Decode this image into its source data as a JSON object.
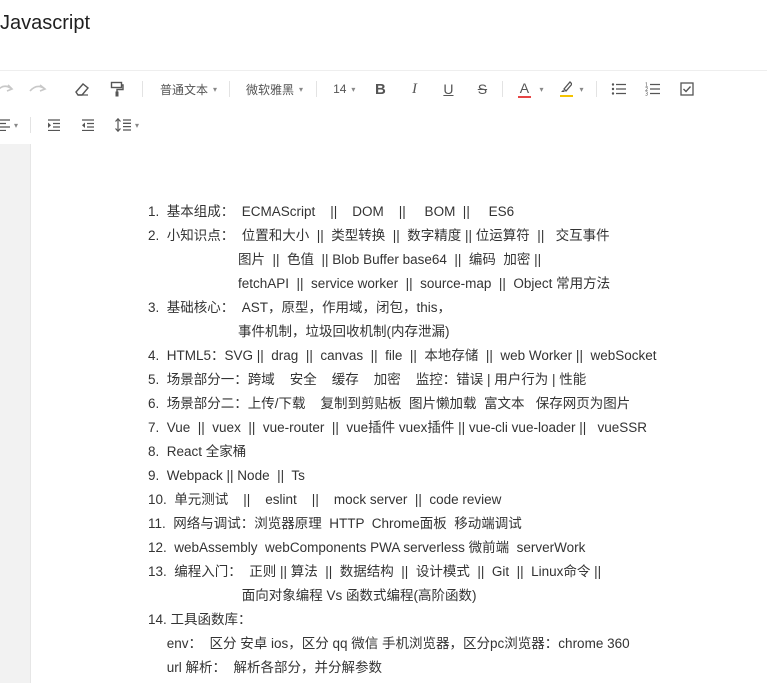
{
  "title": "Javascript",
  "toolbar": {
    "paragraph_style": "普通文本",
    "font_family": "微软雅黑",
    "font_size": "14",
    "bold": "B",
    "italic": "I",
    "underline": "U",
    "strike": "S",
    "font_color_letter": "A",
    "font_color": "#e64545",
    "highlight_color": "#f5c400"
  },
  "document": {
    "lines": [
      "1.  基本组成：  ECMAScript    ||    DOM    ||     BOM  ||     ES6",
      "2.  小知识点：  位置和大小  ||  类型转换  ||  数字精度 || 位运算符  ||   交互事件",
      "                        图片  ||  色值  || Blob Buffer base64  ||  编码  加密 ||",
      "                        fetchAPI  ||  service worker  ||  source-map  ||  Object 常用方法",
      "3.  基础核心：  AST，原型，作用域，闭包，this，",
      "                        事件机制，垃圾回收机制(内存泄漏)",
      "4.  HTML5：SVG ||  drag  ||  canvas  ||  file  ||  本地存储  ||  web Worker ||  webSocket",
      "5.  场景部分一：跨域    安全    缓存    加密    监控：错误 | 用户行为 | 性能",
      "6.  场景部分二：上传/下载    复制到剪贴板  图片懒加载  富文本   保存网页为图片",
      "7.  Vue  ||  vuex  ||  vue-router  ||  vue插件 vuex插件 || vue-cli vue-loader ||   vueSSR",
      "8.  React 全家桶",
      "9.  Webpack || Node  ||  Ts",
      "10.  单元测试    ||    eslint    ||    mock server  ||  code review",
      "11.  网络与调试：浏览器原理  HTTP  Chrome面板  移动端调试",
      "12.  webAssembly  webComponents PWA serverless 微前端  serverWork",
      "13.  编程入门：  正则 || 算法  ||  数据结构  ||  设计模式  ||  Git  ||  Linux命令 ||",
      "                         面向对象编程 Vs 函数式编程(高阶函数)",
      "14. 工具函数库：",
      "     env：  区分 安卓 ios，区分 qq 微信 手机浏览器，区分pc浏览器：chrome 360",
      "     url 解析：  解析各部分，并分解参数"
    ]
  }
}
